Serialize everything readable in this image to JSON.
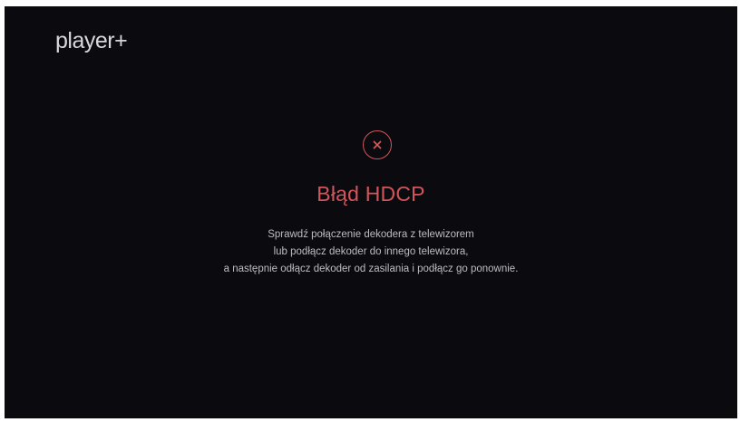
{
  "header": {
    "logo_text": "player+"
  },
  "error": {
    "icon": "close-icon",
    "title": "Błąd HDCP",
    "message_lines": [
      "Sprawdź połączenie dekodera z telewizorem",
      "lub podłącz dekoder do innego telewizora,",
      "a następnie odłącz dekoder od zasilania i podłącz go ponownie."
    ]
  },
  "colors": {
    "background": "#0b0b0f",
    "accent": "#d2555b",
    "text": "#bdbdc0",
    "logo": "#d7d7da"
  }
}
